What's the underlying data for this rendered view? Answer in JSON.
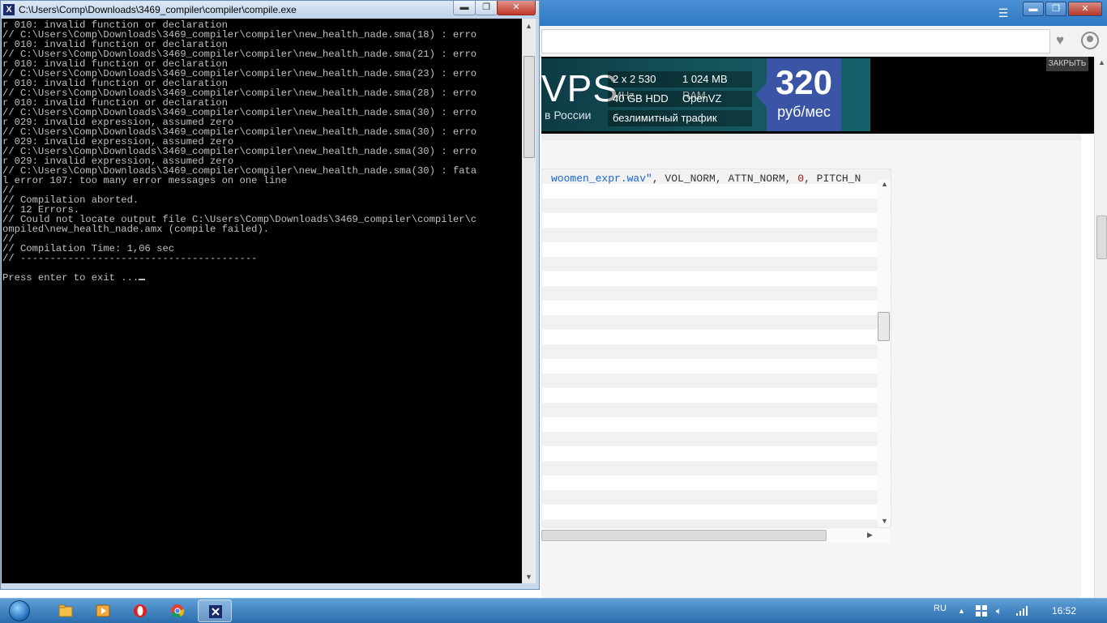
{
  "cmd_window": {
    "title": "C:\\Users\\Comp\\Downloads\\3469_compiler\\compiler\\compile.exe",
    "icon": "cmd-icon",
    "console_lines": [
      "r 010: invalid function or declaration",
      "// C:\\Users\\Comp\\Downloads\\3469_compiler\\compiler\\new_health_nade.sma(18) : erro",
      "r 010: invalid function or declaration",
      "// C:\\Users\\Comp\\Downloads\\3469_compiler\\compiler\\new_health_nade.sma(21) : erro",
      "r 010: invalid function or declaration",
      "// C:\\Users\\Comp\\Downloads\\3469_compiler\\compiler\\new_health_nade.sma(23) : erro",
      "r 010: invalid function or declaration",
      "// C:\\Users\\Comp\\Downloads\\3469_compiler\\compiler\\new_health_nade.sma(28) : erro",
      "r 010: invalid function or declaration",
      "// C:\\Users\\Comp\\Downloads\\3469_compiler\\compiler\\new_health_nade.sma(30) : erro",
      "r 029: invalid expression, assumed zero",
      "// C:\\Users\\Comp\\Downloads\\3469_compiler\\compiler\\new_health_nade.sma(30) : erro",
      "r 029: invalid expression, assumed zero",
      "// C:\\Users\\Comp\\Downloads\\3469_compiler\\compiler\\new_health_nade.sma(30) : erro",
      "r 029: invalid expression, assumed zero",
      "// C:\\Users\\Comp\\Downloads\\3469_compiler\\compiler\\new_health_nade.sma(30) : fata",
      "l error 107: too many error messages on one line",
      "//",
      "// Compilation aborted.",
      "// 12 Errors.",
      "// Could not locate output file C:\\Users\\Comp\\Downloads\\3469_compiler\\compiler\\c",
      "ompiled\\new_health_nade.amx (compile failed).",
      "//",
      "// Compilation Time: 1,06 sec",
      "// ----------------------------------------",
      "",
      "Press enter to exit ..."
    ],
    "buttons": {
      "minimize": "▬",
      "maximize": "❐",
      "close": "✕"
    }
  },
  "browser": {
    "ad": {
      "brand_fragment": "VPS",
      "location": "в России",
      "specs": [
        "2 x 2 530 MHz",
        "1 024 MB RAM",
        "40 GB HDD",
        "OpenVZ",
        "безлимитный трафик"
      ],
      "price": "320",
      "price_unit": "руб/мес",
      "close_label": "ЗАКРЫТЬ"
    },
    "code": {
      "tokens": [
        {
          "text": "woomen_expr.wav\"",
          "kind": "str"
        },
        {
          "text": ", VOL_NORM, ATTN_NORM, ",
          "kind": "plain"
        },
        {
          "text": "0",
          "kind": "num"
        },
        {
          "text": ", PITCH_N",
          "kind": "plain"
        }
      ]
    },
    "icons": [
      "heart-icon",
      "account-icon",
      "menu-icon"
    ]
  },
  "taskbar": {
    "language": "RU",
    "clock": "16:52",
    "apps": [
      "explorer",
      "media-player",
      "opera",
      "chrome",
      "cmd"
    ]
  }
}
